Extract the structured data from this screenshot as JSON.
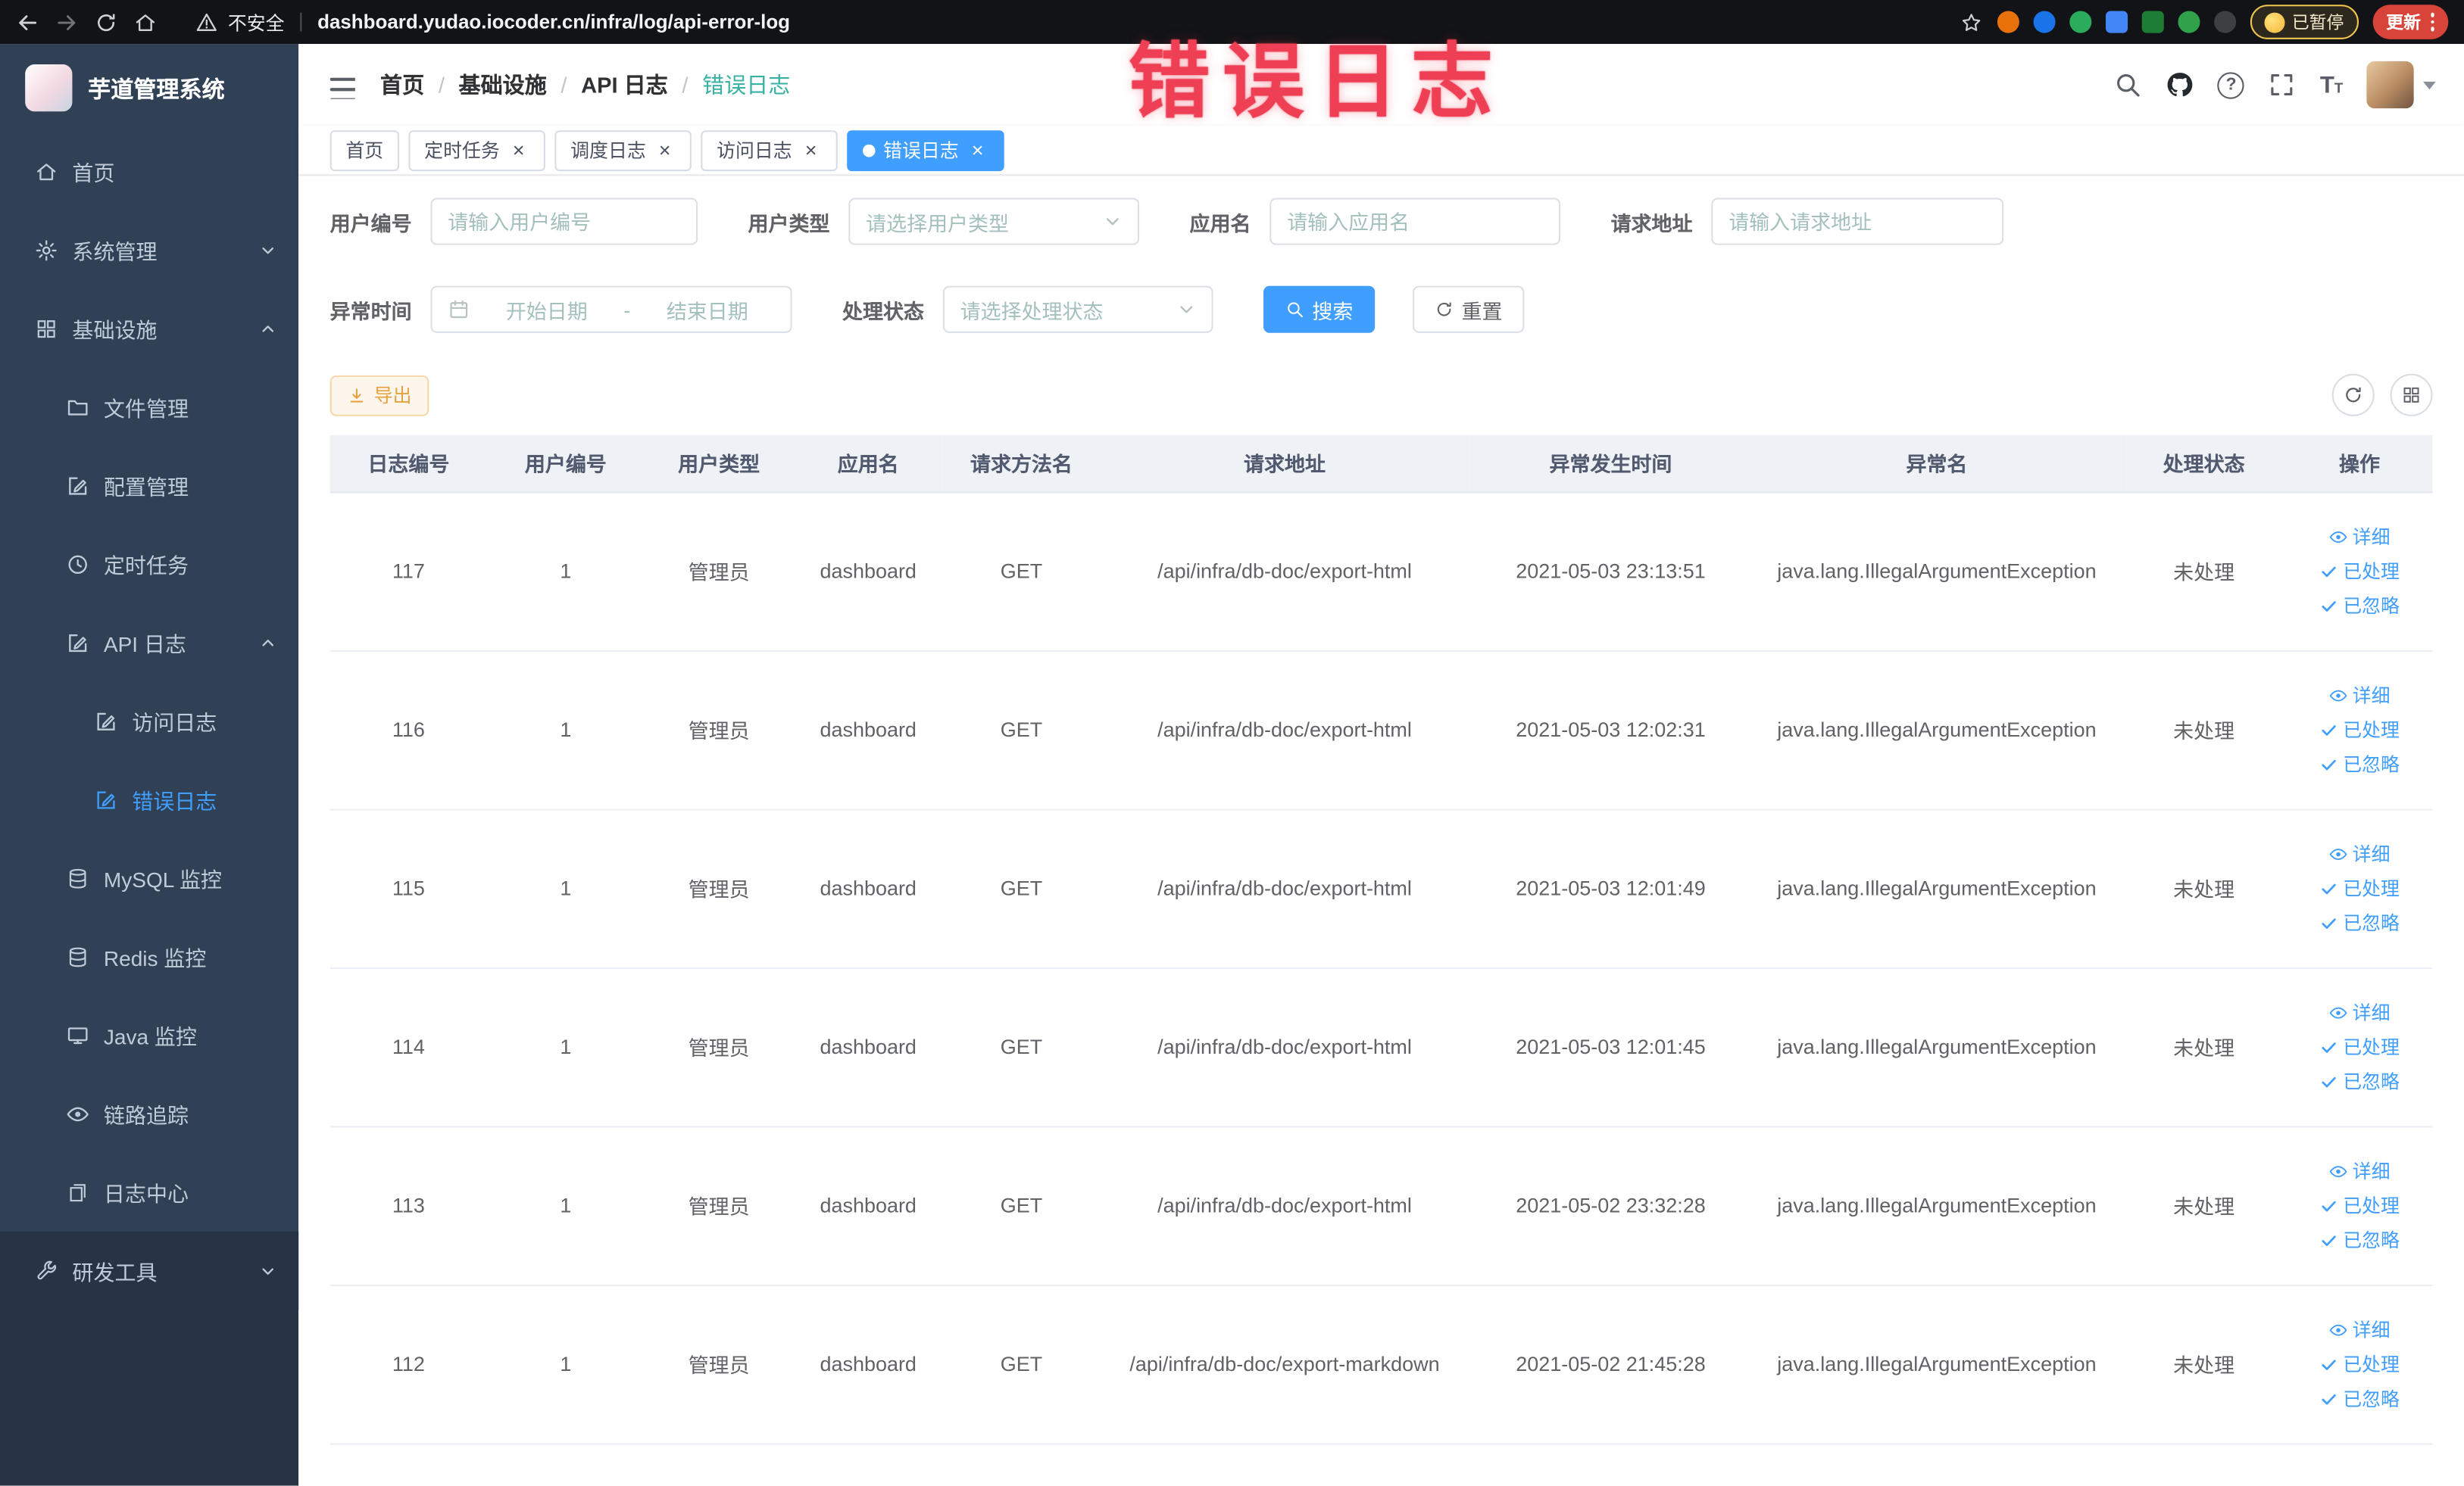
{
  "browser": {
    "security_label": "不安全",
    "url": "dashboard.yudao.iocoder.cn/infra/log/api-error-log",
    "paused_badge": "已暂停",
    "update_button": "更新"
  },
  "annotation": "错误日志",
  "icons": {
    "close": "×",
    "question": "?",
    "font_large": "T",
    "font_small": "T",
    "breadcrumb_separator": "/"
  },
  "colors": {
    "primary": "#409eff",
    "warning": "#e6a23c",
    "annotation_red": "#ee3f55",
    "sidebar_bg": "#304156",
    "sidebar_dark_bg": "#263445",
    "active_breadcrumb": "#38b2a3"
  },
  "sidebar": {
    "logo_title": "芋道管理系统",
    "items": [
      {
        "name": "home",
        "label": "首页",
        "icon": "home-icon",
        "depth": 0
      },
      {
        "name": "system-management",
        "label": "系统管理",
        "icon": "gear-icon",
        "depth": 0,
        "chevron": "down"
      },
      {
        "name": "infrastructure",
        "label": "基础设施",
        "icon": "grid-icon",
        "depth": 0,
        "chevron": "up"
      },
      {
        "name": "file-management",
        "label": "文件管理",
        "icon": "folder-icon",
        "depth": 1
      },
      {
        "name": "config-management",
        "label": "配置管理",
        "icon": "edit-icon",
        "depth": 1
      },
      {
        "name": "scheduled-tasks",
        "label": "定时任务",
        "icon": "clock-icon",
        "depth": 1
      },
      {
        "name": "api-logs",
        "label": "API 日志",
        "icon": "edit-icon",
        "depth": 1,
        "chevron": "up"
      },
      {
        "name": "access-log",
        "label": "访问日志",
        "icon": "edit-icon",
        "depth": 2
      },
      {
        "name": "error-log",
        "label": "错误日志",
        "icon": "edit-icon",
        "depth": 2,
        "active": true
      },
      {
        "name": "mysql-monitor",
        "label": "MySQL 监控",
        "icon": "db-icon",
        "depth": 1
      },
      {
        "name": "redis-monitor",
        "label": "Redis 监控",
        "icon": "db-icon",
        "depth": 1
      },
      {
        "name": "java-monitor",
        "label": "Java 监控",
        "icon": "monitor-icon",
        "depth": 1
      },
      {
        "name": "link-tracing",
        "label": "链路追踪",
        "icon": "eye-icon",
        "depth": 1
      },
      {
        "name": "log-center",
        "label": "日志中心",
        "icon": "docs-icon",
        "depth": 1
      },
      {
        "name": "dev-tools",
        "label": "研发工具",
        "icon": "wrench-icon",
        "depth": 0,
        "chevron": "down",
        "dark": true
      }
    ]
  },
  "header": {
    "breadcrumb": [
      "首页",
      "基础设施",
      "API 日志",
      "错误日志"
    ]
  },
  "tabs": [
    {
      "label": "首页",
      "closable": false,
      "active": false
    },
    {
      "label": "定时任务",
      "closable": true,
      "active": false
    },
    {
      "label": "调度日志",
      "closable": true,
      "active": false
    },
    {
      "label": "访问日志",
      "closable": true,
      "active": false
    },
    {
      "label": "错误日志",
      "closable": true,
      "active": true
    }
  ],
  "filters": {
    "user_id": {
      "label": "用户编号",
      "placeholder": "请输入用户编号"
    },
    "user_type": {
      "label": "用户类型",
      "placeholder": "请选择用户类型"
    },
    "app_name": {
      "label": "应用名",
      "placeholder": "请输入应用名"
    },
    "request_url": {
      "label": "请求地址",
      "placeholder": "请输入请求地址"
    },
    "exception_time": {
      "label": "异常时间",
      "start_placeholder": "开始日期",
      "separator": "-",
      "end_placeholder": "结束日期"
    },
    "process_status": {
      "label": "处理状态",
      "placeholder": "请选择处理状态"
    },
    "search_button": "搜索",
    "reset_button": "重置"
  },
  "toolbar": {
    "export_button": "导出"
  },
  "table": {
    "columns": [
      "日志编号",
      "用户编号",
      "用户类型",
      "应用名",
      "请求方法名",
      "请求地址",
      "异常发生时间",
      "异常名",
      "处理状态",
      "操作"
    ],
    "actions": [
      "详细",
      "已处理",
      "已忽略"
    ],
    "rows": [
      {
        "id": "117",
        "user_id": "1",
        "user_type": "管理员",
        "app": "dashboard",
        "method": "GET",
        "url": "/api/infra/db-doc/export-html",
        "time": "2021-05-03 23:13:51",
        "exception": "java.lang.IllegalArgumentException",
        "status": "未处理"
      },
      {
        "id": "116",
        "user_id": "1",
        "user_type": "管理员",
        "app": "dashboard",
        "method": "GET",
        "url": "/api/infra/db-doc/export-html",
        "time": "2021-05-03 12:02:31",
        "exception": "java.lang.IllegalArgumentException",
        "status": "未处理"
      },
      {
        "id": "115",
        "user_id": "1",
        "user_type": "管理员",
        "app": "dashboard",
        "method": "GET",
        "url": "/api/infra/db-doc/export-html",
        "time": "2021-05-03 12:01:49",
        "exception": "java.lang.IllegalArgumentException",
        "status": "未处理"
      },
      {
        "id": "114",
        "user_id": "1",
        "user_type": "管理员",
        "app": "dashboard",
        "method": "GET",
        "url": "/api/infra/db-doc/export-html",
        "time": "2021-05-03 12:01:45",
        "exception": "java.lang.IllegalArgumentException",
        "status": "未处理"
      },
      {
        "id": "113",
        "user_id": "1",
        "user_type": "管理员",
        "app": "dashboard",
        "method": "GET",
        "url": "/api/infra/db-doc/export-html",
        "time": "2021-05-02 23:32:28",
        "exception": "java.lang.IllegalArgumentException",
        "status": "未处理"
      },
      {
        "id": "112",
        "user_id": "1",
        "user_type": "管理员",
        "app": "dashboard",
        "method": "GET",
        "url": "/api/infra/db-doc/export-markdown",
        "time": "2021-05-02 21:45:28",
        "exception": "java.lang.IllegalArgumentException",
        "status": "未处理"
      }
    ]
  }
}
